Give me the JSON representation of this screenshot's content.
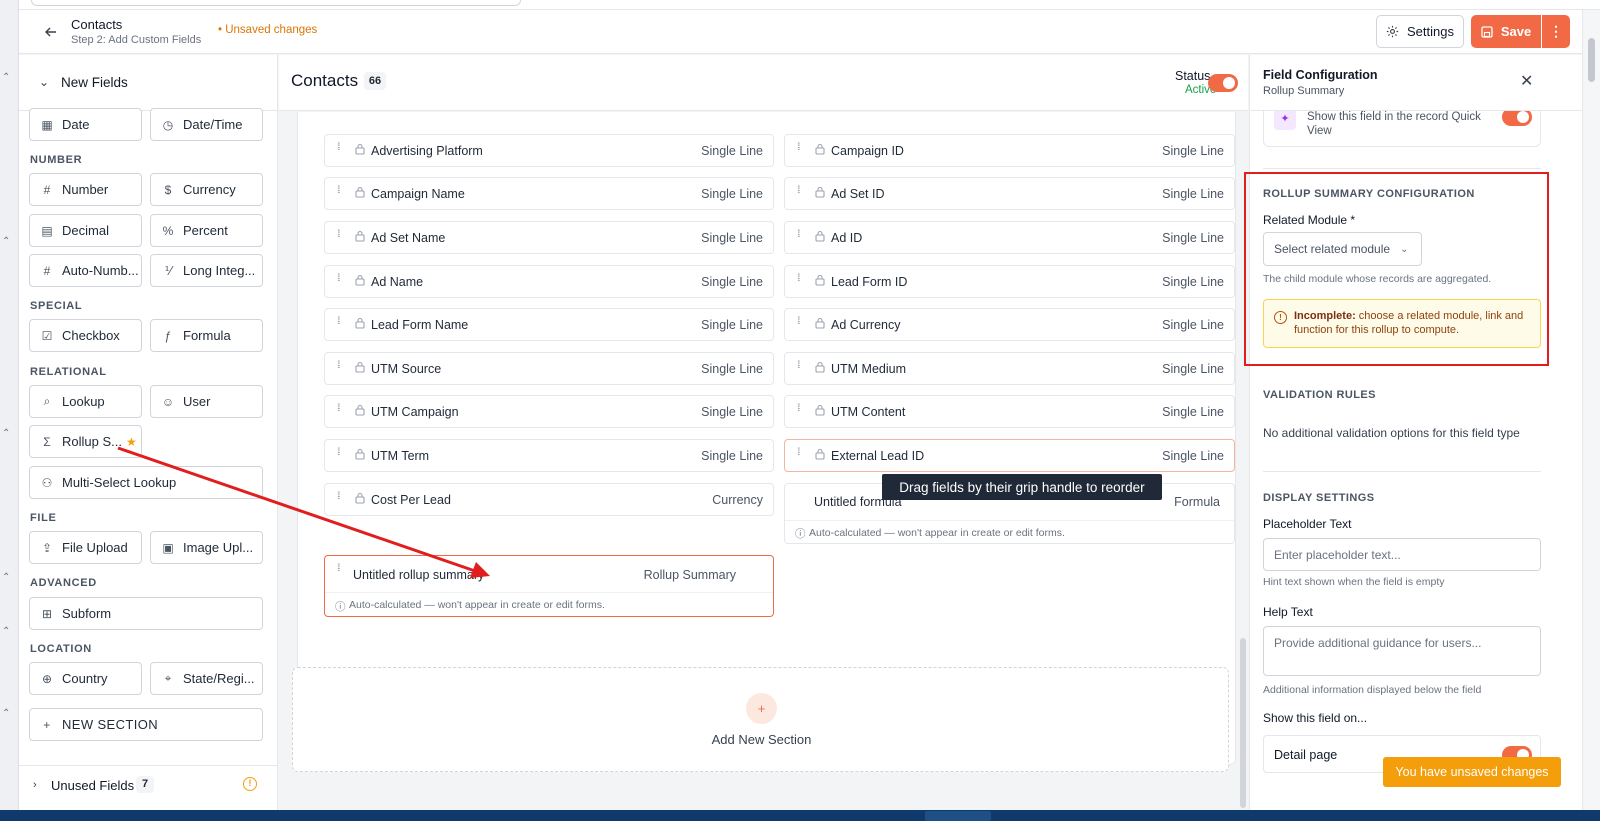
{
  "header": {
    "title": "Contacts",
    "subtitle": "Step 2: Add Custom Fields",
    "unsaved": "• Unsaved changes",
    "settings_label": "Settings",
    "save_label": "Save"
  },
  "left_panel": {
    "new_fields_label": "New Fields",
    "top_row": [
      {
        "label": "Date",
        "icon": "calendar-icon"
      },
      {
        "label": "Date/Time",
        "icon": "calendar-clock-icon"
      }
    ],
    "categories": [
      {
        "name": "NUMBER",
        "items": [
          {
            "label": "Number",
            "icon": "hash-icon"
          },
          {
            "label": "Currency",
            "icon": "dollar-icon"
          },
          {
            "label": "Decimal",
            "icon": "calculator-icon"
          },
          {
            "label": "Percent",
            "icon": "percent-icon"
          },
          {
            "label": "Auto-Numb...",
            "icon": "hash-icon"
          },
          {
            "label": "Long Integ...",
            "icon": "number-icon"
          }
        ]
      },
      {
        "name": "SPECIAL",
        "items": [
          {
            "label": "Checkbox",
            "icon": "checkbox-icon"
          },
          {
            "label": "Formula",
            "icon": "formula-icon"
          }
        ]
      },
      {
        "name": "RELATIONAL",
        "items": [
          {
            "label": "Lookup",
            "icon": "search-icon"
          },
          {
            "label": "User",
            "icon": "user-icon"
          },
          {
            "label": "Rollup S...",
            "icon": "sigma-icon"
          },
          {
            "label": "Multi-Select Lookup",
            "icon": "users-icon"
          }
        ]
      },
      {
        "name": "FILE",
        "items": [
          {
            "label": "File Upload",
            "icon": "file-upload-icon"
          },
          {
            "label": "Image Upl...",
            "icon": "image-icon"
          }
        ]
      },
      {
        "name": "ADVANCED",
        "items": [
          {
            "label": "Subform",
            "icon": "table-icon"
          }
        ]
      },
      {
        "name": "LOCATION",
        "items": [
          {
            "label": "Country",
            "icon": "globe-icon"
          },
          {
            "label": "State/Regi...",
            "icon": "map-pin-icon"
          }
        ]
      }
    ],
    "new_section_label": "NEW SECTION",
    "unused_label": "Unused Fields",
    "unused_count": "7"
  },
  "center": {
    "title": "Contacts",
    "count": "66",
    "status_label": "Status",
    "status_value": "Active",
    "fields_left": [
      {
        "name": "Advertising Platform",
        "type": "Single Line"
      },
      {
        "name": "Campaign Name",
        "type": "Single Line"
      },
      {
        "name": "Ad Set Name",
        "type": "Single Line"
      },
      {
        "name": "Ad Name",
        "type": "Single Line"
      },
      {
        "name": "Lead Form Name",
        "type": "Single Line"
      },
      {
        "name": "UTM Source",
        "type": "Single Line"
      },
      {
        "name": "UTM Campaign",
        "type": "Single Line"
      },
      {
        "name": "UTM Term",
        "type": "Single Line"
      },
      {
        "name": "Cost Per Lead",
        "type": "Currency"
      }
    ],
    "fields_right": [
      {
        "name": "Campaign ID",
        "type": "Single Line"
      },
      {
        "name": "Ad Set ID",
        "type": "Single Line"
      },
      {
        "name": "Ad ID",
        "type": "Single Line"
      },
      {
        "name": "Lead Form ID",
        "type": "Single Line"
      },
      {
        "name": "Ad Currency",
        "type": "Single Line"
      },
      {
        "name": "UTM Medium",
        "type": "Single Line"
      },
      {
        "name": "UTM Content",
        "type": "Single Line"
      },
      {
        "name": "External Lead ID",
        "type": "Single Line"
      }
    ],
    "formula_card": {
      "name": "Untitled formula",
      "type": "Formula",
      "note": "Auto-calculated — won't appear in create or edit forms."
    },
    "rollup_card": {
      "name": "Untitled rollup summary",
      "type": "Rollup Summary",
      "note": "Auto-calculated — won't appear in create or edit forms."
    },
    "add_section_label": "Add New Section",
    "add_plus": "+",
    "tooltip": "Drag fields by their grip handle to reorder"
  },
  "right_panel": {
    "title": "Field Configuration",
    "subtitle": "Rollup Summary",
    "quick_view_text": "Show this field in the record Quick View",
    "rollup_heading": "ROLLUP SUMMARY CONFIGURATION",
    "related_module_label": "Related Module *",
    "related_module_placeholder": "Select related module",
    "related_module_help": "The child module whose records are aggregated.",
    "warning_bold": "Incomplete:",
    "warning_text": " choose a related module, link and function for this rollup to compute.",
    "validation_heading": "VALIDATION RULES",
    "validation_text": "No additional validation options for this field type",
    "display_heading": "DISPLAY SETTINGS",
    "placeholder_label": "Placeholder Text",
    "placeholder_input": "Enter placeholder text...",
    "placeholder_help": "Hint text shown when the field is empty",
    "help_label": "Help Text",
    "help_input": "Provide additional guidance for users...",
    "help_help": "Additional information displayed below the field",
    "show_on_label": "Show this field on...",
    "detail_page_label": "Detail page"
  },
  "toast": "You have unsaved changes",
  "colors": {
    "accent": "#f26a45",
    "warning": "#f59e0b",
    "annotation": "#e11d1d",
    "active": "#16a34a"
  }
}
